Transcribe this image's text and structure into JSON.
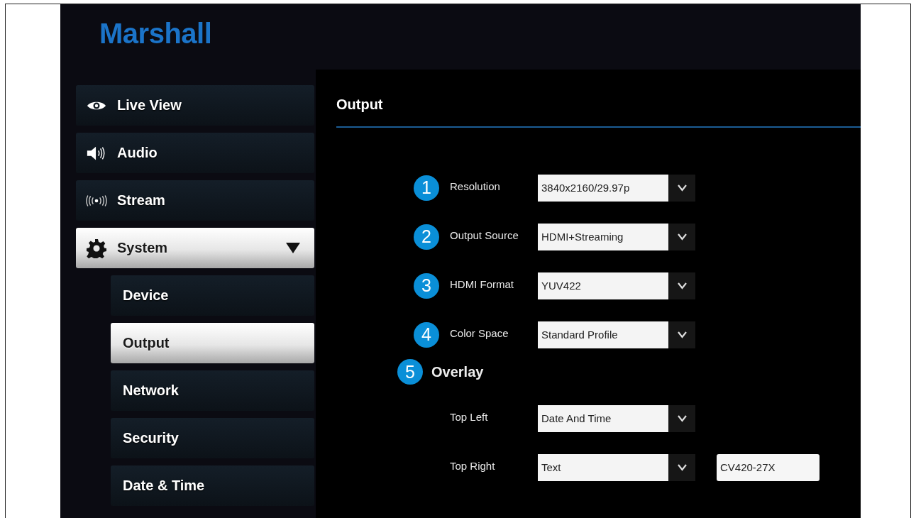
{
  "logo": "Marshall",
  "sidebar": {
    "items": [
      {
        "label": "Live View",
        "kind": "eye",
        "selected": false
      },
      {
        "label": "Audio",
        "kind": "speaker",
        "selected": false
      },
      {
        "label": "Stream",
        "kind": "broadcast",
        "selected": false
      },
      {
        "label": "System",
        "kind": "gear",
        "selected": true,
        "expanded": true,
        "children": [
          {
            "label": "Device",
            "selected": false
          },
          {
            "label": "Output",
            "selected": true
          },
          {
            "label": "Network",
            "selected": false
          },
          {
            "label": "Security",
            "selected": false
          },
          {
            "label": "Date & Time",
            "selected": false
          }
        ]
      }
    ]
  },
  "page": {
    "title": "Output",
    "settings": [
      {
        "badge": "1",
        "label": "Resolution",
        "value": "3840x2160/29.97p"
      },
      {
        "badge": "2",
        "label": "Output Source",
        "value": "HDMI+Streaming"
      },
      {
        "badge": "3",
        "label": "HDMI Format",
        "value": "YUV422"
      },
      {
        "badge": "4",
        "label": "Color Space",
        "value": "Standard Profile"
      }
    ],
    "overlay": {
      "badge": "5",
      "title": "Overlay",
      "settings": [
        {
          "label": "Top Left",
          "value": "Date And Time"
        },
        {
          "label": "Top Right",
          "value": "Text",
          "text_value": "CV420-27X"
        }
      ]
    }
  }
}
